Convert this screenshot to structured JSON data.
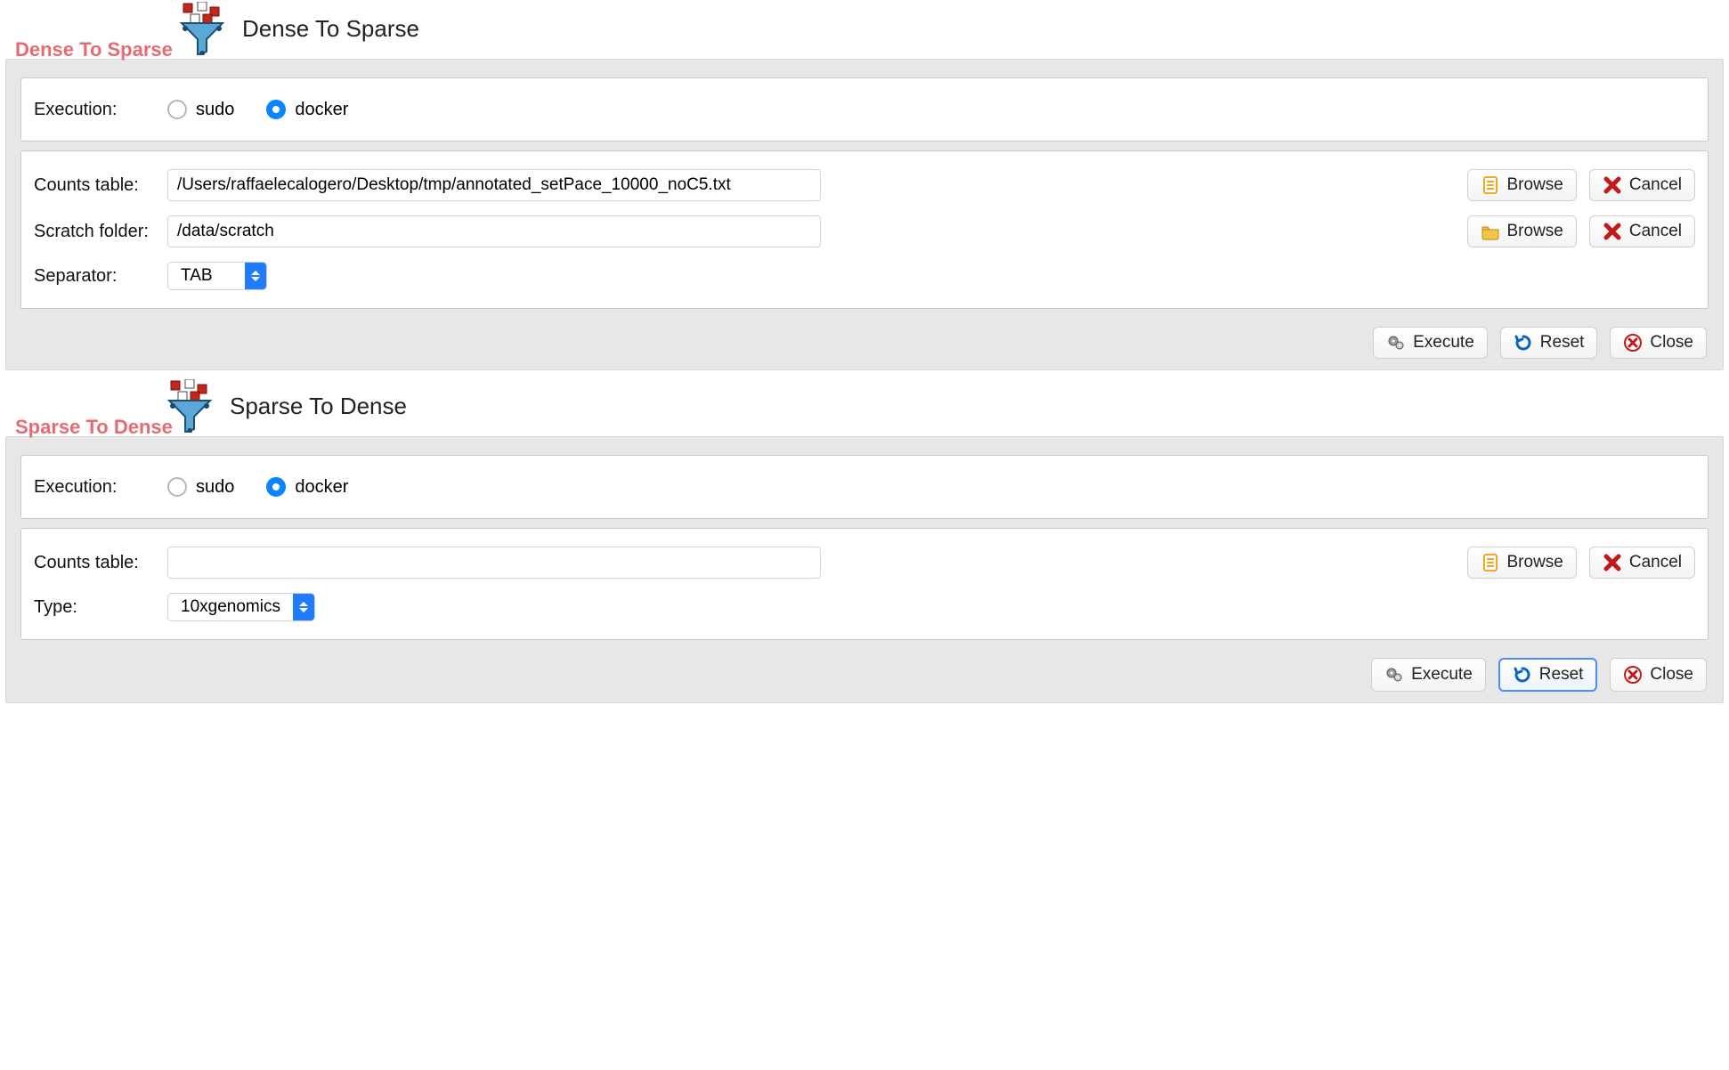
{
  "dense_to_sparse": {
    "header_title": "Dense To Sparse",
    "legend": "Dense To Sparse",
    "execution": {
      "label": "Execution:",
      "options": [
        "sudo",
        "docker"
      ],
      "selected": "docker"
    },
    "counts_table": {
      "label": "Counts table:",
      "value": "/Users/raffaelecalogero/Desktop/tmp/annotated_setPace_10000_noC5.txt",
      "browse": "Browse",
      "cancel": "Cancel"
    },
    "scratch_folder": {
      "label": "Scratch folder:",
      "value": "/data/scratch",
      "browse": "Browse",
      "cancel": "Cancel"
    },
    "separator": {
      "label": "Separator:",
      "value": "TAB"
    },
    "buttons": {
      "execute": "Execute",
      "reset": "Reset",
      "close": "Close"
    }
  },
  "sparse_to_dense": {
    "header_title": "Sparse To Dense",
    "legend": "Sparse To Dense",
    "execution": {
      "label": "Execution:",
      "options": [
        "sudo",
        "docker"
      ],
      "selected": "docker"
    },
    "counts_table": {
      "label": "Counts table:",
      "value": "",
      "browse": "Browse",
      "cancel": "Cancel"
    },
    "type": {
      "label": "Type:",
      "value": "10xgenomics"
    },
    "buttons": {
      "execute": "Execute",
      "reset": "Reset",
      "close": "Close"
    }
  }
}
